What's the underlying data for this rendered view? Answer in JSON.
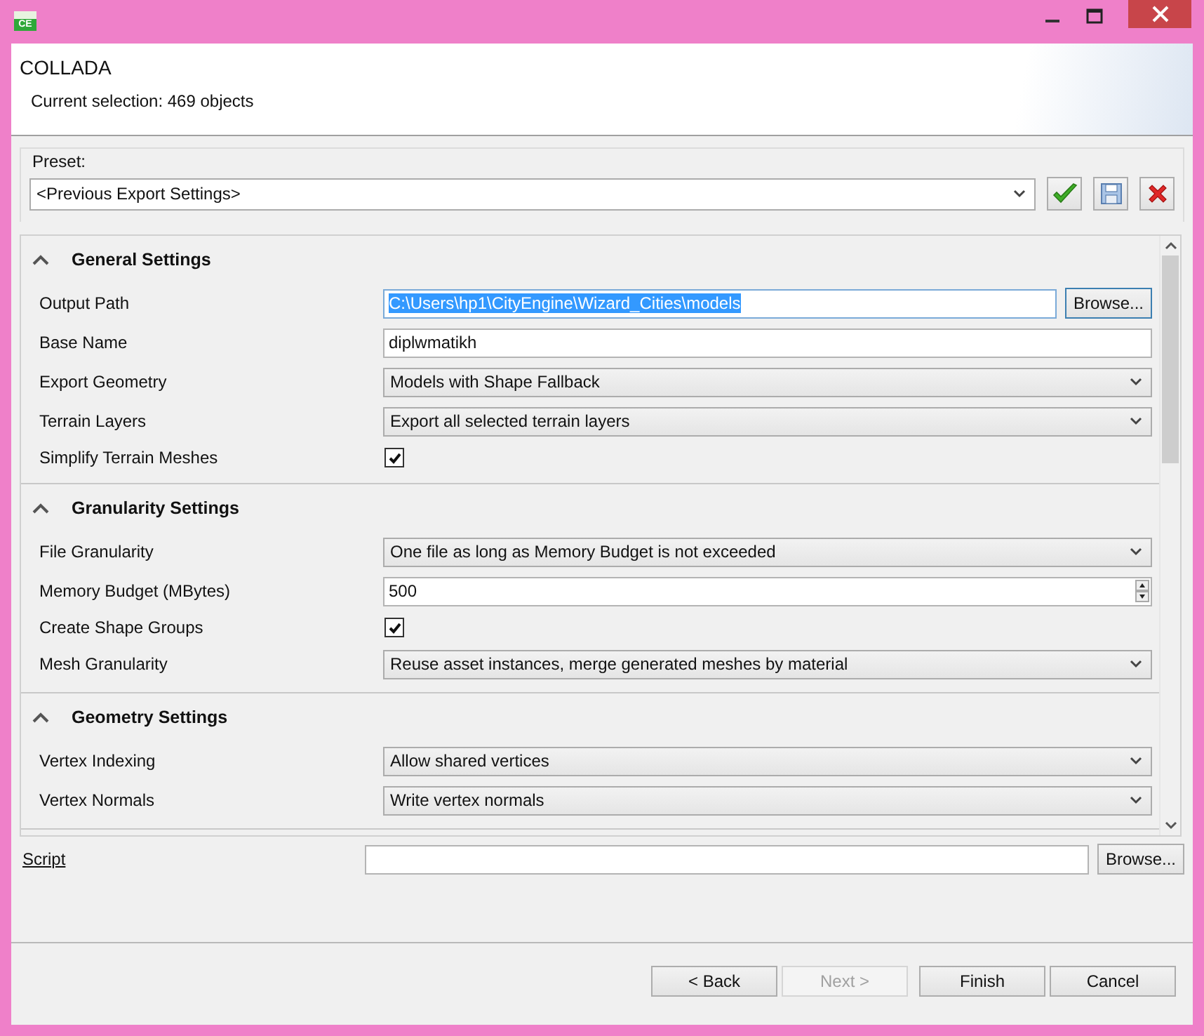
{
  "window": {
    "icon_text": "CE"
  },
  "header": {
    "title": "COLLADA",
    "subtitle": "Current selection: 469 objects"
  },
  "preset": {
    "label": "Preset:",
    "value": "<Previous Export Settings>"
  },
  "sections": [
    {
      "title": "General Settings",
      "expanded": true,
      "rows": [
        {
          "kind": "path",
          "label": "Output Path",
          "value": "C:\\Users\\hp1\\CityEngine\\Wizard_Cities\\models",
          "highlighted": true,
          "button": "Browse..."
        },
        {
          "kind": "text",
          "label": "Base Name",
          "value": "diplwmatikh"
        },
        {
          "kind": "select",
          "label": "Export Geometry",
          "value": "Models with Shape Fallback"
        },
        {
          "kind": "select",
          "label": "Terrain Layers",
          "value": "Export all selected terrain layers"
        },
        {
          "kind": "checkbox",
          "label": "Simplify Terrain Meshes",
          "checked": true
        }
      ]
    },
    {
      "title": "Granularity Settings",
      "expanded": true,
      "rows": [
        {
          "kind": "select",
          "label": "File Granularity",
          "value": "One file as long as Memory Budget is not exceeded"
        },
        {
          "kind": "spinner",
          "label": "Memory Budget (MBytes)",
          "value": "500"
        },
        {
          "kind": "checkbox",
          "label": "Create Shape Groups",
          "checked": true
        },
        {
          "kind": "select",
          "label": "Mesh Granularity",
          "value": "Reuse asset instances, merge generated meshes by material"
        }
      ]
    },
    {
      "title": "Geometry Settings",
      "expanded": true,
      "rows": [
        {
          "kind": "select",
          "label": "Vertex Indexing",
          "value": "Allow shared vertices"
        },
        {
          "kind": "select",
          "label": "Vertex Normals",
          "value": "Write vertex normals"
        }
      ]
    }
  ],
  "script": {
    "label": "Script",
    "button": "Browse..."
  },
  "buttons": [
    {
      "label": "< Back",
      "disabled": false
    },
    {
      "label": "Next >",
      "disabled": true
    },
    {
      "label": "Finish",
      "disabled": false
    },
    {
      "label": "Cancel",
      "disabled": false
    }
  ]
}
